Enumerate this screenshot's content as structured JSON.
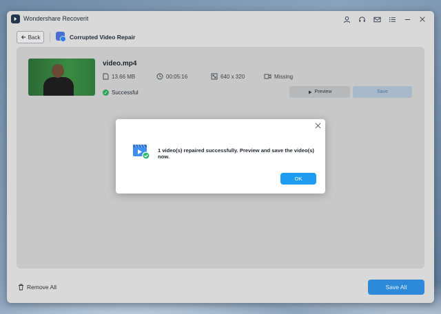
{
  "app": {
    "title": "Wondershare Recoverit"
  },
  "titlebar": {
    "icons": [
      "user-icon",
      "headset-icon",
      "mail-icon",
      "list-icon",
      "minimize-icon",
      "close-icon"
    ]
  },
  "nav": {
    "back_label": "Back",
    "page_title": "Corrupted Video Repair"
  },
  "video": {
    "file_name": "video.mp4",
    "size": "13.66  MB",
    "duration": "00:05:16",
    "resolution": "640 x 320",
    "audio": "Missing",
    "status": "Successful",
    "preview_label": "Preview",
    "save_label": "Save"
  },
  "footer": {
    "remove_all_label": "Remove All",
    "save_all_label": "Save All"
  },
  "dialog": {
    "message": "1 video(s) repaired successfully. Preview and save the video(s) now.",
    "ok_label": "OK"
  },
  "colors": {
    "accent": "#1f9cf0",
    "success": "#2fa35a",
    "save_all": "#2c8ad8"
  }
}
